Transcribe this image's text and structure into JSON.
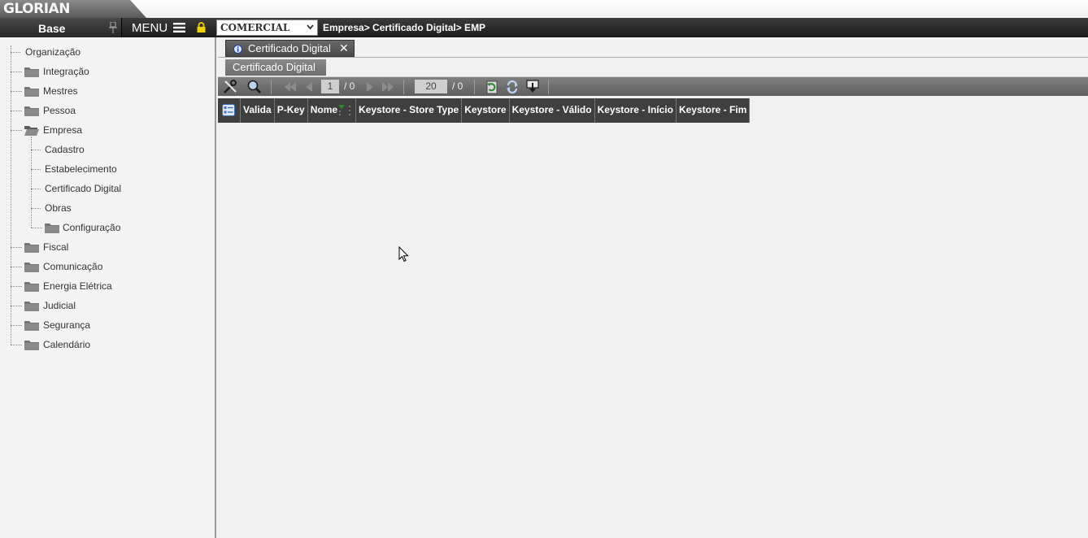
{
  "app": {
    "logo_text": "GLORIAN",
    "base_label": "Base",
    "menu_label": "MENU",
    "company": "COMERCIAL",
    "breadcrumb": "Empresa> Certificado Digital> EMP"
  },
  "sidebar": {
    "items": [
      {
        "label": "Organização",
        "folder": false
      },
      {
        "label": "Integração",
        "folder": true
      },
      {
        "label": "Mestres",
        "folder": true
      },
      {
        "label": "Pessoa",
        "folder": true
      },
      {
        "label": "Empresa",
        "folder": true,
        "open": true
      },
      {
        "label": "Cadastro",
        "folder": false
      },
      {
        "label": "Estabelecimento",
        "folder": false
      },
      {
        "label": "Certificado Digital",
        "folder": false
      },
      {
        "label": "Obras",
        "folder": false
      },
      {
        "label": "Configuração",
        "folder": true
      },
      {
        "label": "Fiscal",
        "folder": true
      },
      {
        "label": "Comunicação",
        "folder": true
      },
      {
        "label": "Energia Elétrica",
        "folder": true
      },
      {
        "label": "Judicial",
        "folder": true
      },
      {
        "label": "Segurança",
        "folder": true
      },
      {
        "label": "Calendário",
        "folder": true
      }
    ]
  },
  "tabs": {
    "main_tab": "Certificado Digital",
    "sub_tab": "Certificado Digital"
  },
  "toolbar": {
    "page_current": "1",
    "page_total": "/ 0",
    "page_size": "20",
    "records_total": "/ 0"
  },
  "grid": {
    "columns": [
      "Valida",
      "P-Key",
      "Nome",
      "Keystore - Store Type",
      "Keystore",
      "Keystore - Válido",
      "Keystore - Início",
      "Keystore - Fim"
    ]
  },
  "colors": {
    "header_dark": "#1c1c1c",
    "toolbar_grey": "#6f6f6f",
    "lock_yellow": "#f2d000",
    "folder_grey": "#757575"
  }
}
